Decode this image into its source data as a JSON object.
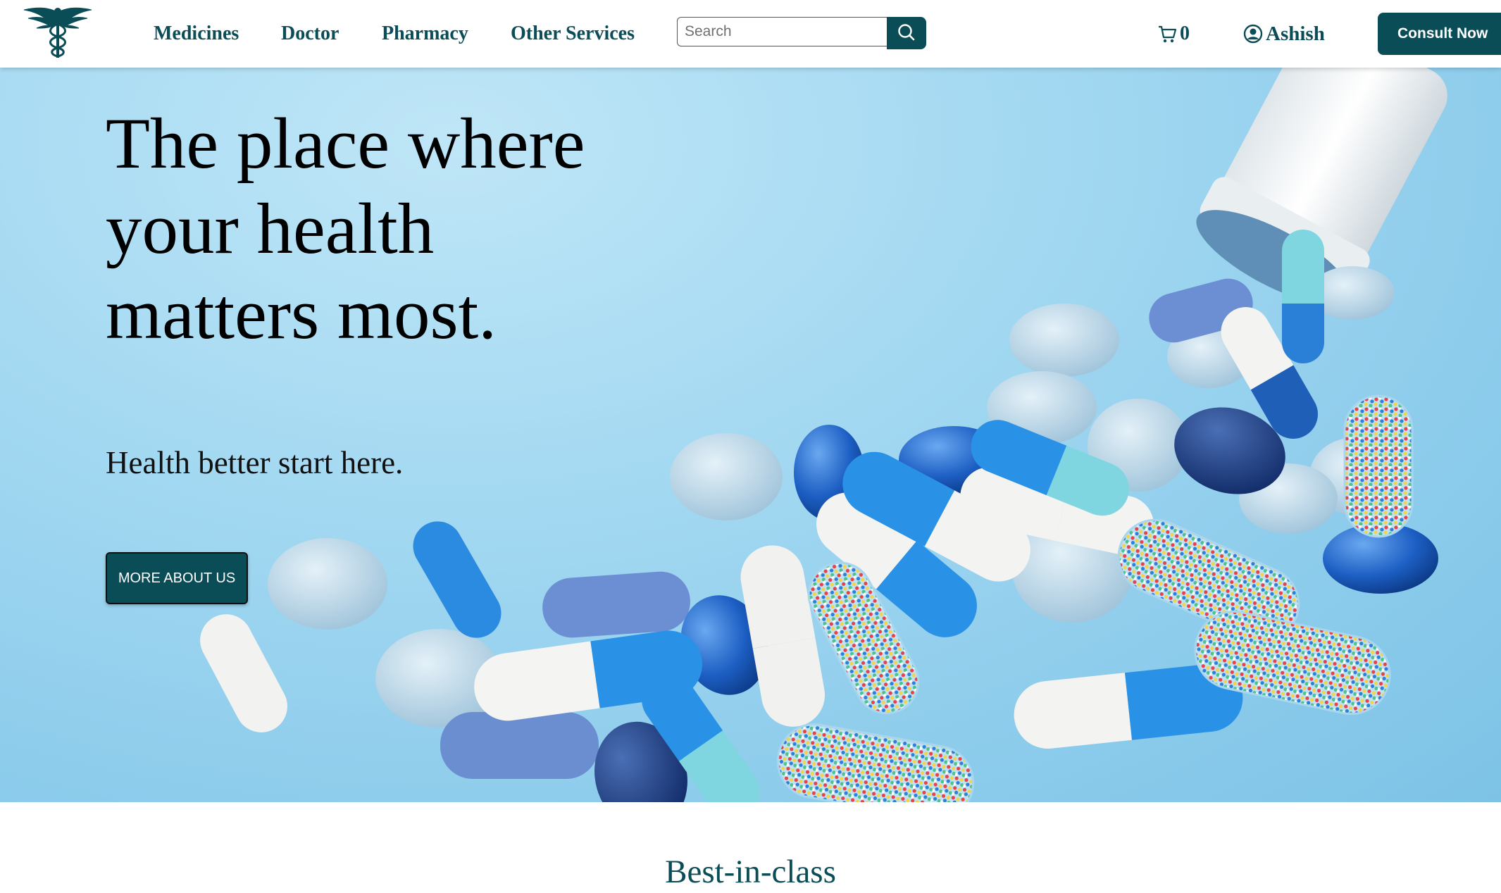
{
  "brand": {
    "logo_icon": "caduceus-icon",
    "accent_color": "#0b4d57"
  },
  "nav": {
    "links": [
      "Medicines",
      "Doctor",
      "Pharmacy",
      "Other Services"
    ],
    "search_placeholder": "Search",
    "search_icon": "search-icon",
    "cart_icon": "cart-icon",
    "cart_count": "0",
    "user_icon": "user-circle-icon",
    "user_name": "Ashish",
    "consult_label": "Consult Now"
  },
  "hero": {
    "title": "The place where your health matters most.",
    "subtitle": "Health better start here.",
    "cta_label": "MORE ABOUT US",
    "background_color": "#a6daf2"
  },
  "section": {
    "heading": "Best-in-class"
  }
}
